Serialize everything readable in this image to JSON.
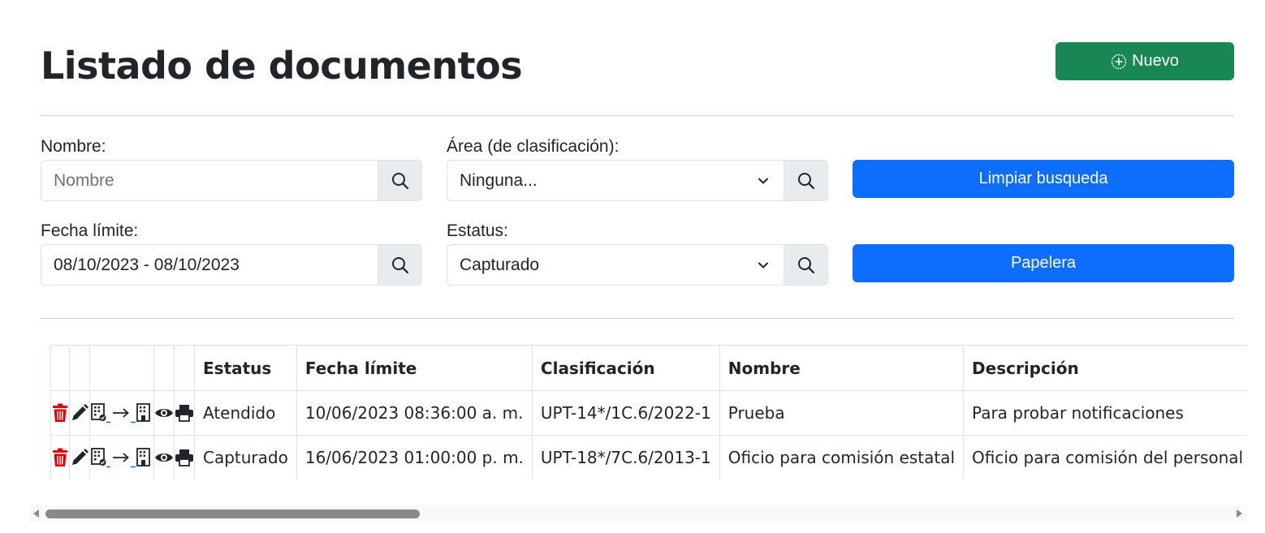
{
  "header": {
    "title": "Listado de documentos",
    "new_button_label": "Nuevo"
  },
  "filters": {
    "nombre": {
      "label": "Nombre:",
      "placeholder": "Nombre",
      "value": ""
    },
    "area": {
      "label": "Área (de clasificación):",
      "selected": "Ninguna..."
    },
    "fecha": {
      "label": "Fecha límite:",
      "value": "08/10/2023 - 08/10/2023"
    },
    "estatus": {
      "label": "Estatus:",
      "selected": "Capturado"
    },
    "clear_button_label": "Limpiar busqueda",
    "trash_button_label": "Papelera"
  },
  "table": {
    "columns": [
      "Estatus",
      "Fecha límite",
      "Clasificación",
      "Nombre",
      "Descripción"
    ],
    "rows": [
      {
        "estatus": "Atendido",
        "fecha": "10/06/2023 08:36:00 a. m.",
        "clasificacion": "UPT-14*/1C.6/2022-1",
        "nombre": "Prueba",
        "descripcion": "Para probar notificaciones"
      },
      {
        "estatus": "Capturado",
        "fecha": "16/06/2023 01:00:00 p. m.",
        "clasificacion": "UPT-18*/7C.6/2013-1",
        "nombre": "Oficio para comisión estatal",
        "descripcion": "Oficio para comisión del personal"
      }
    ],
    "row_action_icons": [
      "trash-icon",
      "pencil-icon",
      "transfer-building-icon",
      "eye-icon",
      "printer-icon"
    ]
  },
  "colors": {
    "primary": "#0d6efd",
    "success": "#198754",
    "danger": "#e00000",
    "addon_bg": "#e9ecef",
    "text": "#212529"
  }
}
